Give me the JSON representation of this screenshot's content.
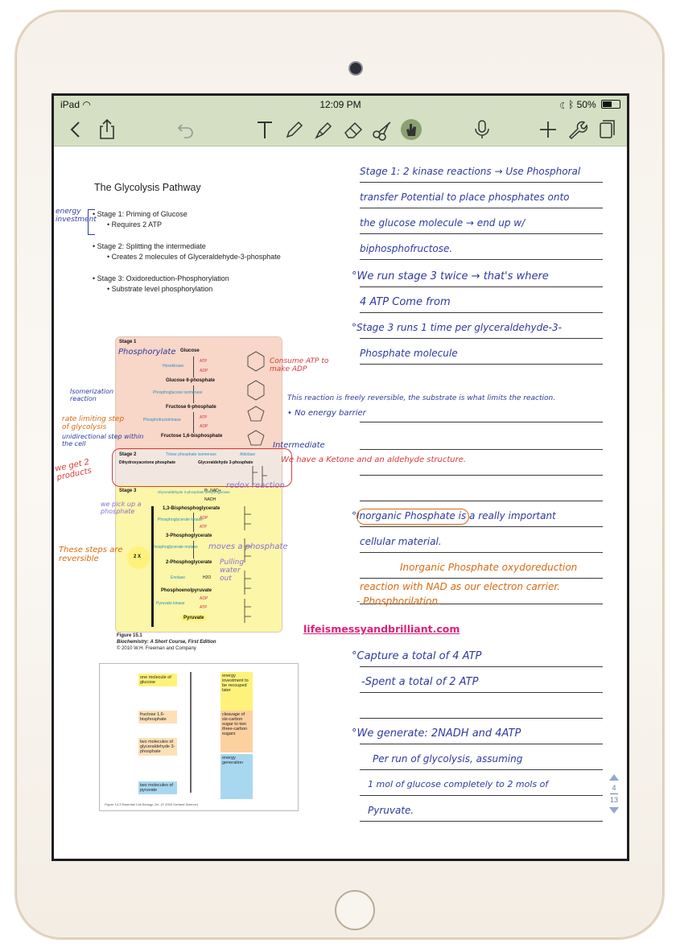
{
  "status_bar": {
    "carrier": "iPad",
    "time": "12:09 PM",
    "battery": "50%",
    "battery_level": 0.5
  },
  "toolbar": {
    "back": "back-chevron-icon",
    "share": "share-icon",
    "undo": "undo-icon",
    "text_tool": "text-tool-icon",
    "pen": "pen-icon",
    "highlighter": "highlighter-icon",
    "eraser": "eraser-icon",
    "scissors": "scissors-icon",
    "hand": "hand-icon",
    "mic": "microphone-icon",
    "add": "plus-icon",
    "settings": "wrench-icon",
    "pages": "pages-icon"
  },
  "slide": {
    "title": "The Glycolysis Pathway",
    "stage1": "Stage 1: Priming of Glucose",
    "stage1_sub": "Requires 2 ATP",
    "stage2": "Stage 2: Splitting the intermediate",
    "stage2_sub": "Creates 2 molecules of Glyceraldehyde-3-phosphate",
    "stage3": "Stage 3: Oxidoreduction-Phosphorylation",
    "stage3_sub": "Substrate level phosphorylation"
  },
  "figure1": {
    "stage1": "Stage 1",
    "stage2": "Stage 2",
    "stage3": "Stage 3",
    "glucose": "Glucose",
    "hexokinase": "Hexokinase",
    "g6p": "Glucose 6-phosphate",
    "phosphoglucose_isomerase": "Phosphoglucose isomerase",
    "f6p": "Fructose 6-phosphate",
    "phosphofructokinase": "Phosphofructokinase",
    "f16bp": "Fructose 1,6-bisphosphate",
    "dhap": "Dihydroxyacetone phosphate",
    "tpi": "Triose phosphate isomerase",
    "aldolase": "Aldolase",
    "gap": "Glyceraldehyde 3-phosphate",
    "gapdh": "Glyceraldehyde 3-phosphate dehydrogenase",
    "bpg": "1,3-Bisphosphoglycerate",
    "pgk": "Phosphoglycerate kinase",
    "pg3": "3-Phosphoglycerate",
    "pgm": "Phosphoglycerate mutase",
    "pg2": "2-Phosphoglycerate",
    "enolase": "Enolase",
    "pep": "Phosphoenolpyruvate",
    "pk": "Pyruvate kinase",
    "pyruvate": "Pyruvate",
    "atp": "ATP",
    "adp": "ADP",
    "pi_nad": "Pi, NAD+",
    "nadh": "NADH",
    "h2o": "H2O",
    "x2": "2 X",
    "caption_title": "Figure 15.1",
    "caption_book": "Biochemistry: A Short Course, First Edition",
    "caption_copy": "© 2010 W.H. Freeman and Company"
  },
  "figure2": {
    "one_glucose": "one molecule of glucose",
    "energy_investment": "energy investment to be recouped later",
    "f16bp": "fructose 1,6-bisphosphate",
    "cleavage": "cleavage of six-carbon sugar to two three-carbon sugars",
    "two_gap": "two molecules of glyceraldehyde 3-phosphate",
    "energy_generation": "energy generation",
    "two_pyruvate": "two molecules of pyruvate",
    "caption": "Figure 13-3  Essential Cell Biology, 2/e. (© 2004 Garland Science)"
  },
  "left_annotations": {
    "energy_investment": "energy investment",
    "phosphorylate": "Phosphorylate",
    "consume_atp": "Consume ATP to make ADP",
    "isomerization": "Isomerization reaction",
    "rate_limiting": "rate limiting step of glycolysis",
    "unidirectional": "unidirectional step within the cell",
    "we_get_2": "we get 2 products",
    "reversible_note": "This reaction is freely reversible, the substrate is what limits the reaction.",
    "no_energy": "• No energy barrier",
    "intermediate": "Intermediate",
    "ketone": "We have a Ketone and an aldehyde structure.",
    "redox": "redox reaction",
    "pick_phosphate": "we pick up a phosphate",
    "moves_phosphate": "moves a phosphate",
    "pulling_water": "Pulling water out",
    "steps_reversible": "These steps are reversible"
  },
  "notes": {
    "n1": "Stage 1: 2 kinase reactions → Use Phosphoral",
    "n2": "transfer Potential to place phosphates onto",
    "n3": "the glucose molecule → end up w/",
    "n4": "biphosphofructose.",
    "n5": "°We run stage 3 twice → that's where",
    "n6": "4 ATP Come from",
    "n7": "°Stage 3 runs 1 time per glyceraldehyde-3-",
    "n8": "Phosphate molecule",
    "n9": "°Inorganic Phosphate is a really important",
    "n10": "cellular material.",
    "n11": "Inorganic Phosphate oxydoreduction",
    "n12": "reaction with NAD as our electron carrier.",
    "n13": "- Phosphorilation.",
    "n14": "°Capture a total of 4 ATP",
    "n15": "-Spent a total of 2 ATP",
    "n16": "°We generate: 2NADH and 4ATP",
    "n17": "Per run of glycolysis, assuming",
    "n18": "1 mol of glucose completely to 2 mols of",
    "n19": "Pyruvate."
  },
  "watermark": "lifeismessyandbrilliant.com",
  "pager": {
    "current": "4",
    "total": "13"
  },
  "colors": {
    "toolbar": "#d5dfc3",
    "ink_blue": "#2e3aa0",
    "ink_orange": "#d86a10",
    "ink_red": "#d83a3a",
    "ink_purple": "#8870d8",
    "watermark": "#e0207a"
  }
}
